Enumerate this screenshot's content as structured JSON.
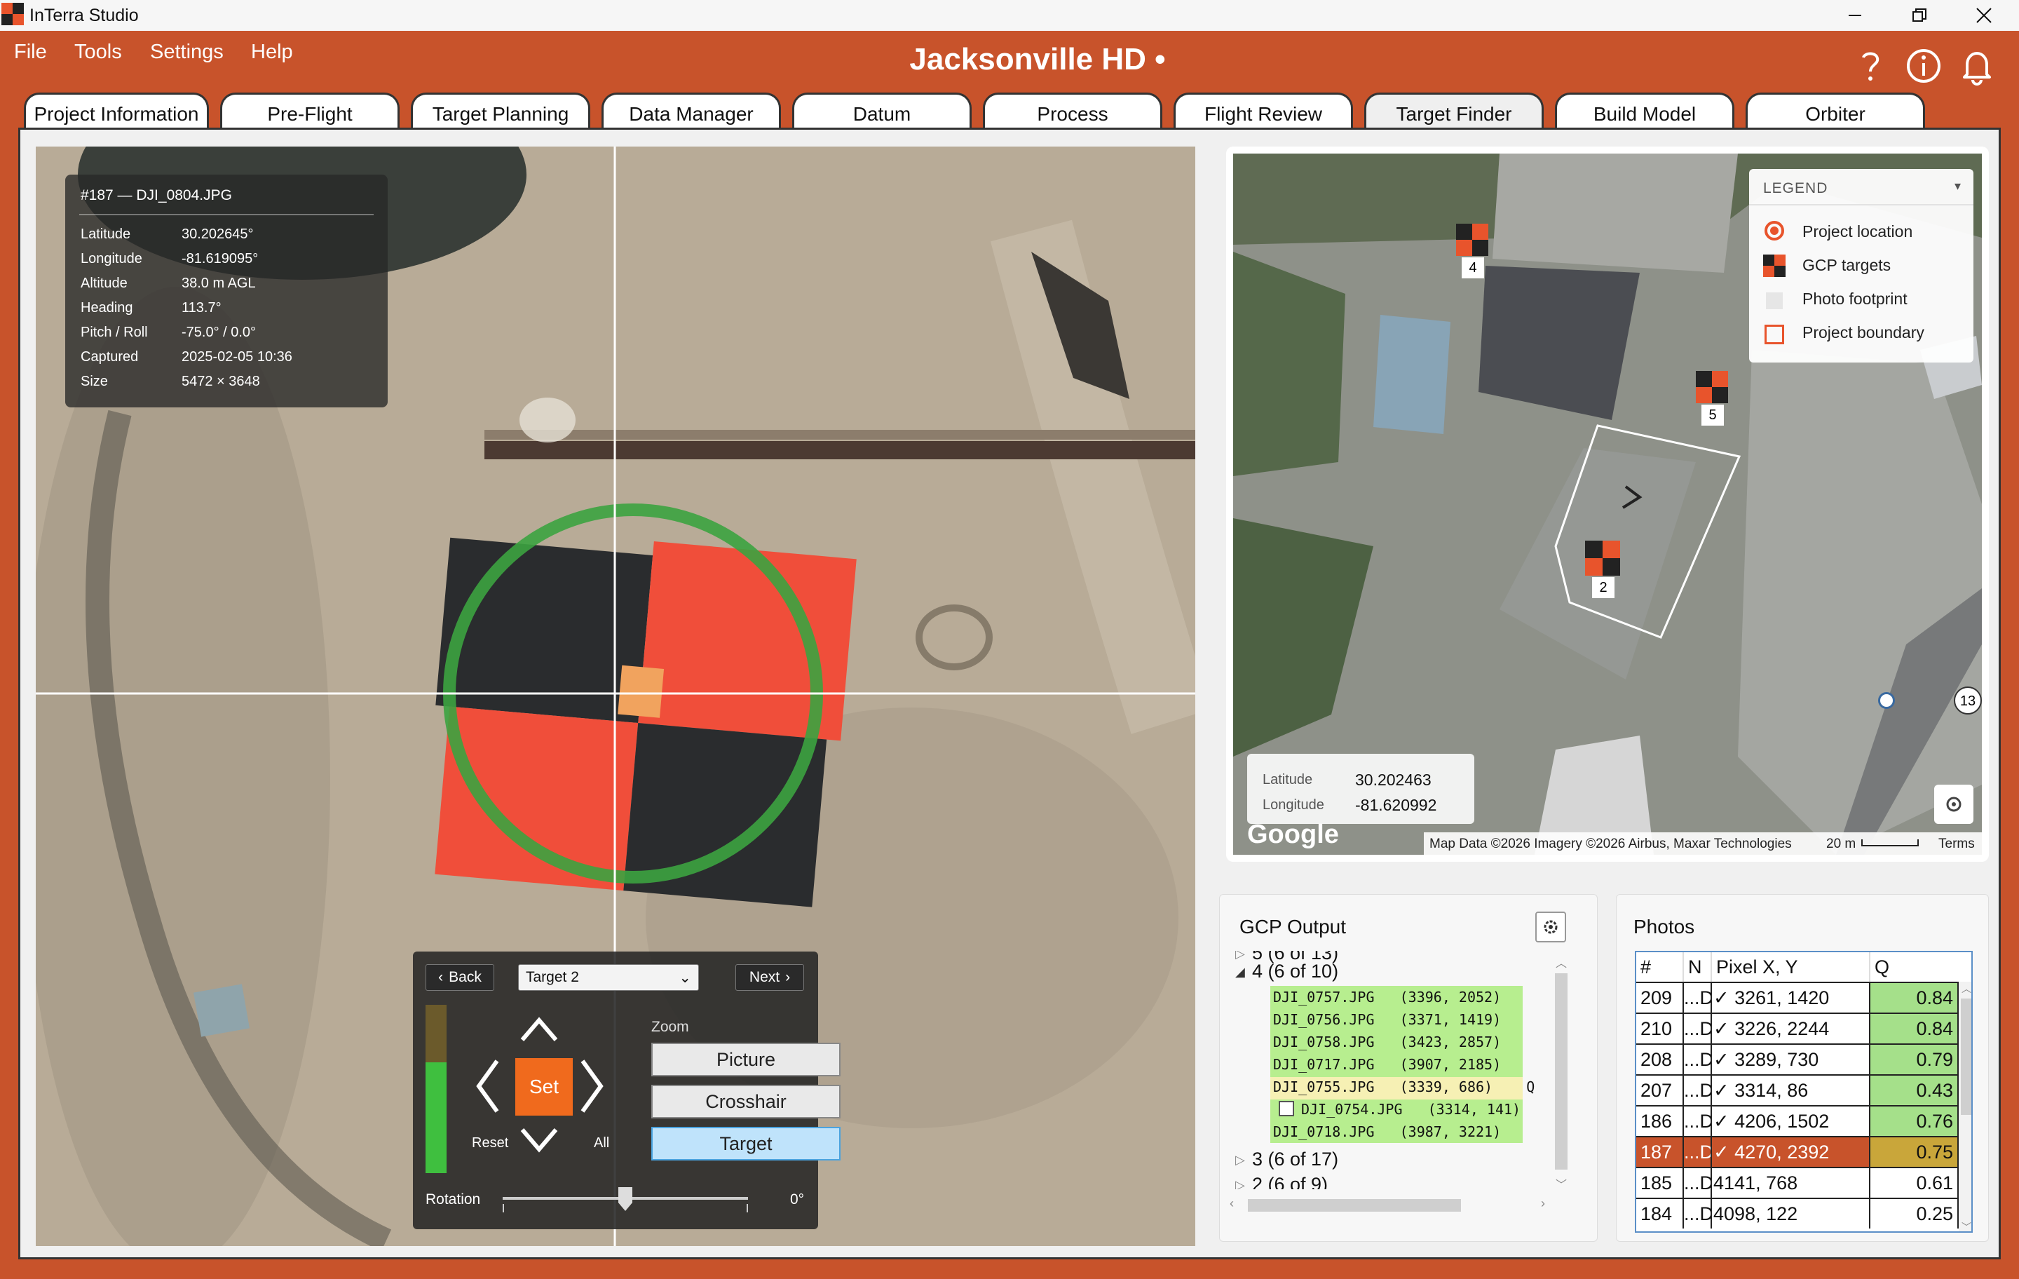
{
  "window": {
    "title": "InTerra Studio"
  },
  "menu": {
    "items": [
      "File",
      "Tools",
      "Settings",
      "Help"
    ]
  },
  "app_title": "Jacksonville HD •",
  "header_icons": [
    "help-icon",
    "info-icon",
    "bell-icon"
  ],
  "tabs": [
    {
      "label": "Project Information"
    },
    {
      "label": "Pre-Flight"
    },
    {
      "label": "Target Planning"
    },
    {
      "label": "Data Manager"
    },
    {
      "label": "Datum"
    },
    {
      "label": "Process"
    },
    {
      "label": "Flight Review"
    },
    {
      "label": "Target Finder",
      "active": true
    },
    {
      "label": "Build Model"
    },
    {
      "label": "Orbiter"
    }
  ],
  "photo_info": {
    "title": "#187 — DJI_0804.JPG",
    "rows": [
      {
        "k": "Latitude",
        "v": "30.202645°"
      },
      {
        "k": "Longitude",
        "v": "-81.619095°"
      },
      {
        "k": "Altitude",
        "v": "38.0 m AGL"
      },
      {
        "k": "Heading",
        "v": "113.7°"
      },
      {
        "k": "Pitch / Roll",
        "v": "-75.0° / 0.0°"
      },
      {
        "k": "Captured",
        "v": "2025-02-05 10:36"
      },
      {
        "k": "Size",
        "v": "5472 × 3648"
      }
    ]
  },
  "controls": {
    "back": "Back",
    "next": "Next",
    "target_select": "Target 2",
    "set": "Set",
    "reset": "Reset",
    "all": "All",
    "zoom_label": "Zoom",
    "zoom_buttons": [
      "Picture",
      "Crosshair",
      "Target"
    ],
    "zoom_selected": "Target",
    "rotation_label": "Rotation",
    "rotation_value": "0°",
    "rotation_fraction": 0.5
  },
  "map": {
    "legend_title": "LEGEND",
    "legend": [
      "Project location",
      "GCP targets",
      "Photo footprint",
      "Project boundary"
    ],
    "markers": [
      "4",
      "5",
      "2",
      "13"
    ],
    "latitude_label": "Latitude",
    "latitude": "30.202463",
    "longitude_label": "Longitude",
    "longitude": "-81.620992",
    "google": "Google",
    "attribution": "Map Data ©2026 Imagery ©2026 Airbus, Maxar Technologies",
    "scale": "20 m",
    "terms": "Terms"
  },
  "gcp_output": {
    "title": "GCP Output",
    "nodes": [
      {
        "label": "5  (6 of 13)"
      },
      {
        "label": "4  (6 of 10)"
      },
      {
        "label": "3  (6 of 17)"
      },
      {
        "label": "2  (6 of 9)"
      }
    ],
    "files": [
      {
        "text": "DJI_0757.JPG   (3396, 2052)"
      },
      {
        "text": "DJI_0756.JPG   (3371, 1419)"
      },
      {
        "text": "DJI_0758.JPG   (3423, 2857)"
      },
      {
        "text": "DJI_0717.JPG   (3907, 2185)"
      },
      {
        "text": "DJI_0755.JPG   (3339, 686)    Q"
      },
      {
        "text": "DJI_0754.JPG   (3314, 141)"
      },
      {
        "text": "DJI_0718.JPG   (3987, 3221)"
      }
    ]
  },
  "photos": {
    "title": "Photos",
    "headers": [
      "#",
      "N",
      "Pixel X, Y",
      "Q"
    ],
    "rows": [
      {
        "num": "209",
        "n": "...D",
        "pix": "✓ 3261, 1420",
        "q": "0.84"
      },
      {
        "num": "210",
        "n": "...D",
        "pix": "✓ 3226, 2244",
        "q": "0.84"
      },
      {
        "num": "208",
        "n": "...D",
        "pix": "✓ 3289, 730",
        "q": "0.79"
      },
      {
        "num": "207",
        "n": "...D",
        "pix": "✓ 3314, 86",
        "q": "0.43"
      },
      {
        "num": "186",
        "n": "...D",
        "pix": "✓ 4206, 1502",
        "q": "0.76"
      },
      {
        "num": "187",
        "n": "...D",
        "pix": "✓ 4270, 2392",
        "q": "0.75"
      },
      {
        "num": "185",
        "n": "...D",
        "pix": "4141, 768",
        "q": "0.61"
      },
      {
        "num": "184",
        "n": "...D",
        "pix": "4098, 122",
        "q": "0.25"
      }
    ],
    "selected_row": "187"
  },
  "colors": {
    "accent": "#c8532b",
    "target_red": "#f0503a",
    "quality_green": "#a5e08a",
    "quality_amber": "#c9a63a"
  }
}
